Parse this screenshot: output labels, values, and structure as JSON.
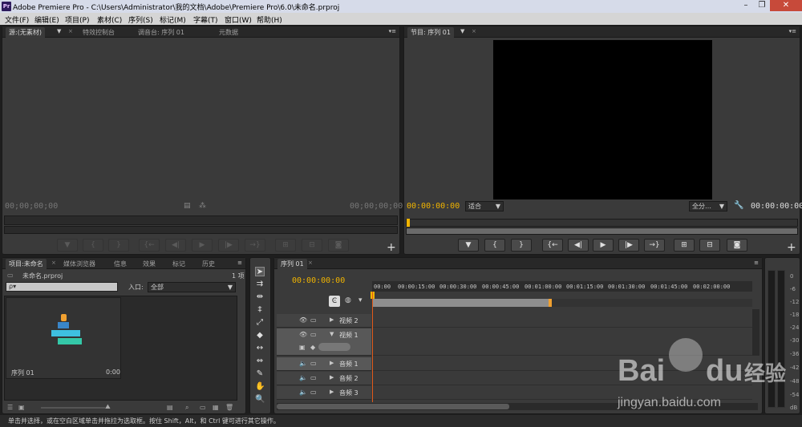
{
  "window": {
    "title": "Adobe Premiere Pro - C:\\Users\\Administrator\\我的文档\\Adobe\\Premiere Pro\\6.0\\未命名.prproj",
    "app_icon": "Pr"
  },
  "menu": [
    "文件(F)",
    "编辑(E)",
    "项目(P)",
    "素材(C)",
    "序列(S)",
    "标记(M)",
    "字幕(T)",
    "窗口(W)",
    "帮助(H)"
  ],
  "source_panel": {
    "tabs": [
      "源:(无素材)",
      "特效控制台",
      "调音台: 序列 01",
      "元数据"
    ],
    "timecode_left": "00;00;00;00",
    "timecode_right": "00;00;00;00"
  },
  "program_panel": {
    "tab": "节目: 序列 01",
    "timecode_left": "00:00:00:00",
    "fit_label": "适合",
    "quality_label": "全分…",
    "timecode_right": "00:00:00:00"
  },
  "project_panel": {
    "tabs": [
      "项目:未命名",
      "媒体浏览器",
      "信息",
      "效果",
      "标记",
      "历史"
    ],
    "filename": "未命名.prproj",
    "item_count": "1 项",
    "search_placeholder": "ρ▾",
    "in_label": "入口:",
    "in_value": "全部",
    "item_name": "序列 01",
    "item_duration": "0:00"
  },
  "timeline": {
    "tab": "序列 01",
    "timecode": "00:00:00:00",
    "ruler": [
      "00:00",
      "00:00:15:00",
      "00:00:30:00",
      "00:00:45:00",
      "00:01:00:00",
      "00:01:15:00",
      "00:01:30:00",
      "00:01:45:00",
      "00:02:00:00"
    ],
    "tracks": [
      "视频 2",
      "视频 1",
      "音频 1",
      "音频 2",
      "音频 3"
    ]
  },
  "audio_meter": {
    "labels": [
      "0",
      "-6",
      "-12",
      "-18",
      "-24",
      "-30",
      "-36",
      "-42",
      "-48",
      "-54",
      "dB"
    ]
  },
  "statusbar": {
    "text": "单击并选择，或在空白区域单击并拖拉为选取框。按住 Shift，Alt，和 Ctrl 键可进行其它操作。"
  },
  "watermark": {
    "brand": "Bai",
    "brand2": "du",
    "cn": "经验",
    "url": "jingyan.baidu.com"
  },
  "colors": {
    "accent_timecode": "#f1b400",
    "panel_bg": "#3a3a3a",
    "playhead": "#e05a1a"
  }
}
